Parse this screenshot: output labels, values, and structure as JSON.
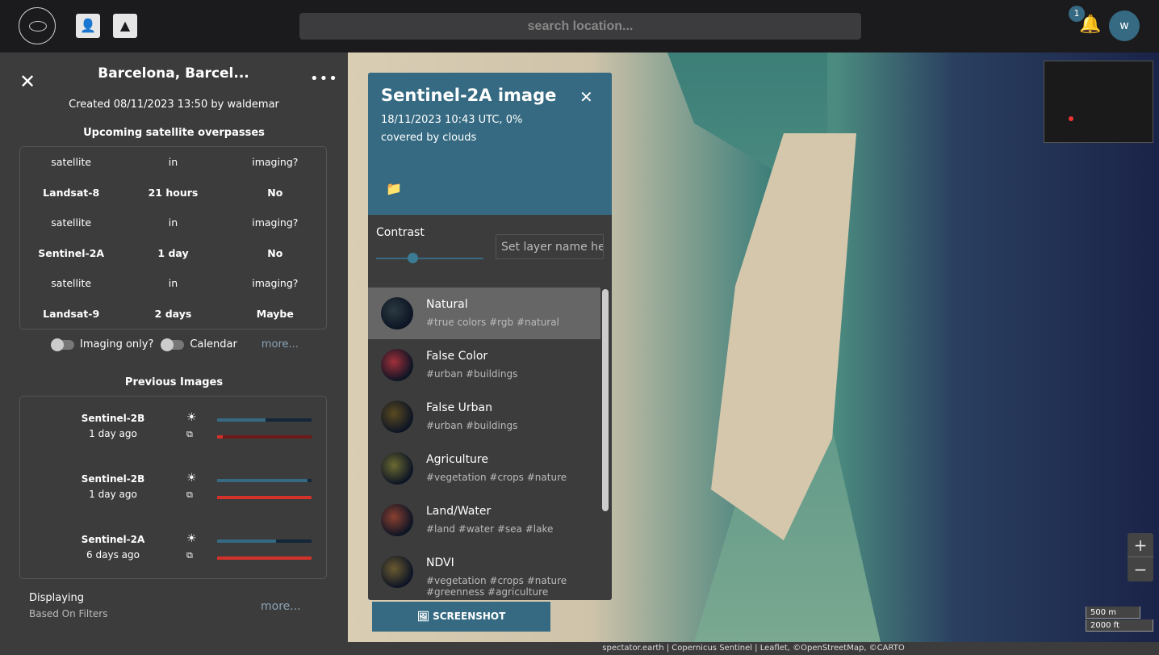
{
  "header": {
    "search_placeholder": "search location...",
    "notification_count": "1",
    "avatar_initial": "w"
  },
  "sidebar": {
    "title": "Barcelona, Barcel...",
    "created": "Created 08/11/2023 13:50 by waldemar",
    "overpasses_heading": "Upcoming satellite overpasses",
    "overpasses": [
      {
        "h": [
          "satellite",
          "in",
          "imaging?"
        ],
        "v": [
          "Landsat-8",
          "21 hours",
          "No"
        ]
      },
      {
        "h": [
          "satellite",
          "in",
          "imaging?"
        ],
        "v": [
          "Sentinel-2A",
          "1 day",
          "No"
        ]
      },
      {
        "h": [
          "satellite",
          "in",
          "imaging?"
        ],
        "v": [
          "Landsat-9",
          "2 days",
          "Maybe"
        ]
      }
    ],
    "imaging_only": "Imaging only?",
    "calendar": "Calendar",
    "more": "more...",
    "previous_heading": "Previous Images",
    "previous": [
      {
        "satellite": "Sentinel-2B",
        "ago": "1 day ago",
        "sun": 0.51,
        "cloud": 0.06
      },
      {
        "satellite": "Sentinel-2B",
        "ago": "1 day ago",
        "sun": 0.96,
        "cloud": 1.0
      },
      {
        "satellite": "Sentinel-2A",
        "ago": "6 days ago",
        "sun": 0.62,
        "cloud": 1.0
      }
    ],
    "displaying": "Displaying",
    "based_on": "Based On  Filters",
    "more2": "more..."
  },
  "panel": {
    "title": "Sentinel-2A image",
    "subtitle": "18/11/2023 10:43 UTC, 0% covered by clouds",
    "contrast_label": "Contrast",
    "contrast_value": 0.34,
    "layer_name_placeholder": "Set layer name here",
    "layers": [
      {
        "name": "Natural",
        "tags": "#true colors #rgb #natural",
        "selected": true
      },
      {
        "name": "False Color",
        "tags": "#urban #buildings"
      },
      {
        "name": "False Urban",
        "tags": "#urban #buildings"
      },
      {
        "name": "Agriculture",
        "tags": "#vegetation #crops #nature"
      },
      {
        "name": "Land/Water",
        "tags": "#land #water #sea #lake"
      },
      {
        "name": "NDVI",
        "tags": "#vegetation #crops #nature #greenness #agriculture"
      }
    ],
    "screenshot": "SCREENSHOT"
  },
  "map": {
    "zoom_in": "+",
    "zoom_out": "−",
    "scale_m": "500 m",
    "scale_ft": "2000 ft",
    "attribution": "spectator.earth  |  Copernicus Sentinel  |  Leaflet, ©OpenStreetMap, ©CARTO"
  },
  "colors": {
    "accent": "#356a82",
    "sun_bar_bg": "#13263a",
    "cloud_bar": "#d2322a",
    "cloud_bar_bg": "#6e1a18"
  }
}
